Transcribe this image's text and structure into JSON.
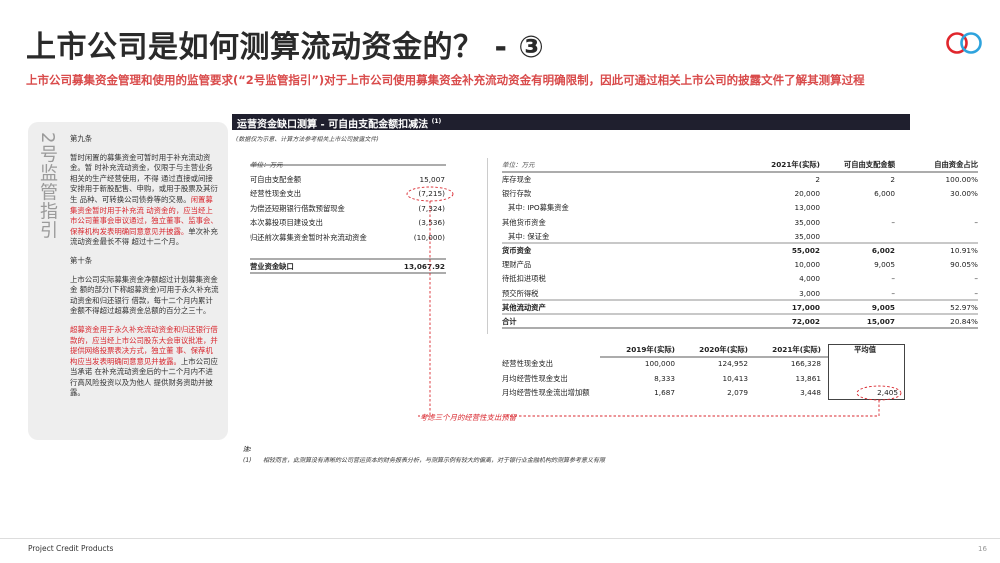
{
  "header": {
    "title": "上市公司是如何测算流动资金的？ - ③",
    "subtitle": "上市公司募集资金管理和使用的监管要求(“2号监管指引”)对于上市公司使用募集资金补充流动资金有明确限制，因此可通过相关上市公司的披露文件了解其测算过程",
    "logo_icon": "double-ring-logo"
  },
  "colors": {
    "accent_red": "#d9282f",
    "header_bar": "#1f1f2e",
    "logo_red": "#e0262c",
    "logo_blue": "#2ea3dd"
  },
  "side_panel": {
    "vertical_label": "2号监管指引",
    "art9_heading": "第九条",
    "art9_text": "暂时闲置的募集资金可暂时用于补充流动资金。暂 时补充流动资金，仅限于与主营业务相关的生产经营使用，不得 通过直接或间接安排用于新股配售、申购，或用于股票及其衍生 品种、可转换公司债券等的交易。",
    "art9_red": "闲置募集资金暂时用于补充流 动资金的，应当经上市公司董事会审议通过，独立董事、监事会、 保荐机构发表明确同意意见并披露。",
    "art9_tail": "单次补充流动资金最长不得 超过十二个月。",
    "art10_heading": "第十条",
    "art10_text": "上市公司实际募集资金净额超过计划募集资金金 额的部分(下称超募资金)可用于永久补充流动资金和归还银行 借款，每十二个月内累计金额不得超过超募资金总额的百分之三十。",
    "art10_red": "超募资金用于永久补充流动资金和归还银行借款的，应当经上市公司股东大会审议批准，并提供网络投票表决方式，独立董 事、保荐机构应当发表明确同意意见并披露。",
    "art10_tail": "上市公司应当承诺 在补充流动资金后的十二个月内不进行高风险投资以及为他人 提供财务资助并披露。"
  },
  "section": {
    "title": "运营资金缺口测算 - 可自由支配金额扣减法",
    "footnote_marker": "(1)",
    "note": "(数据仅为示意、计算方法参考相关上市公司披露文件)"
  },
  "left_table": {
    "unit": "单位：万元",
    "rows": [
      {
        "label": "可自由支配金额",
        "value": "15,007"
      },
      {
        "label": "经营性现金支出",
        "value": "(7,215)"
      },
      {
        "label": "为偿还短期银行借款预留现金",
        "value": "(7,324)"
      },
      {
        "label": "本次募投项目建设支出",
        "value": "(3,536)"
      },
      {
        "label": "归还前次募集资金暂时补充流动资金",
        "value": "(10,000)"
      }
    ],
    "total": {
      "label": "营业资金缺口",
      "value": "13,067.92"
    }
  },
  "right_table": {
    "unit": "单位：万元",
    "headers": [
      "2021年(实际)",
      "可自由支配金额",
      "自由资金占比"
    ],
    "rows": [
      {
        "label": "库存现金",
        "v1": "2",
        "v2": "2",
        "v3": "100.00%",
        "bold": false,
        "indent": false
      },
      {
        "label": "银行存款",
        "v1": "20,000",
        "v2": "6,000",
        "v3": "30.00%",
        "bold": false,
        "indent": false
      },
      {
        "label": "其中: IPO募集资金",
        "v1": "13,000",
        "v2": "",
        "v3": "",
        "bold": false,
        "indent": true
      },
      {
        "label": "其他货币资金",
        "v1": "35,000",
        "v2": "–",
        "v3": "–",
        "bold": false,
        "indent": false
      },
      {
        "label": "其中: 保证金",
        "v1": "35,000",
        "v2": "",
        "v3": "",
        "bold": false,
        "indent": true
      },
      {
        "label": "货币资金",
        "v1": "55,002",
        "v2": "6,002",
        "v3": "10.91%",
        "bold": true,
        "indent": false
      },
      {
        "label": "理财产品",
        "v1": "10,000",
        "v2": "9,005",
        "v3": "90.05%",
        "bold": false,
        "indent": false
      },
      {
        "label": "待抵扣进项税",
        "v1": "4,000",
        "v2": "–",
        "v3": "–",
        "bold": false,
        "indent": false
      },
      {
        "label": "预交所得税",
        "v1": "3,000",
        "v2": "–",
        "v3": "–",
        "bold": false,
        "indent": false
      },
      {
        "label": "其他流动资产",
        "v1": "17,000",
        "v2": "9,005",
        "v3": "52.97%",
        "bold": true,
        "indent": false
      },
      {
        "label": "合计",
        "v1": "72,002",
        "v2": "15,007",
        "v3": "20.84%",
        "bold": true,
        "indent": false
      }
    ]
  },
  "bottom_table": {
    "headers": [
      "2019年(实际)",
      "2020年(实际)",
      "2021年(实际)",
      "平均值"
    ],
    "rows": [
      {
        "label": "经营性现金支出",
        "v1": "100,000",
        "v2": "124,952",
        "v3": "166,328",
        "v4": ""
      },
      {
        "label": "月均经营性现金支出",
        "v1": "8,333",
        "v2": "10,413",
        "v3": "13,861",
        "v4": ""
      },
      {
        "label": "月均经营性现金流出增加额",
        "v1": "1,687",
        "v2": "2,079",
        "v3": "3,448",
        "v4": "2,405"
      }
    ]
  },
  "annotation": "考虑三个月的经营性支出预留",
  "notes": {
    "heading": "注:",
    "n1_marker": "(1)",
    "n1": "相较而言，此测算没有清晰的公司营运资本的财务报表分析，与测算示例有较大的偏离，对于银行业金融机构的测算参考意义有限"
  },
  "footer": {
    "left": "Project Credit Products",
    "page": "16"
  }
}
